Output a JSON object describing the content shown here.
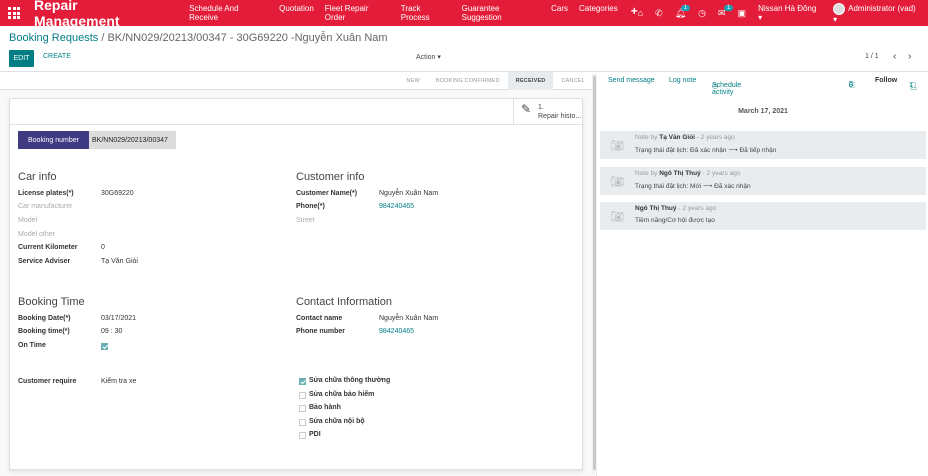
{
  "app": {
    "title": "Repair Management"
  },
  "menu": [
    "Schedule And Receive",
    "Quotation",
    "Fleet Repair Order",
    "Track Process",
    "Guarantee Suggestion",
    "Cars",
    "Categories"
  ],
  "systray": {
    "msg_count": "1",
    "chat_count": "1",
    "company": "Nissan Hà Đông",
    "user": "Administrator (vad)"
  },
  "breadcrumb": {
    "parent": "Booking Requests",
    "sep": "/",
    "current": "BK/NN029/20213/00347 - 30G69220 -Nguyễn Xuân Nam"
  },
  "buttons": {
    "edit": "EDIT",
    "create": "CREATE",
    "action": "Action",
    "pager": "1 / 1"
  },
  "stages": [
    "NEW",
    "BOOKING CONFIRMED",
    "RECEIVED",
    "CANCEL"
  ],
  "active_stage": "RECEIVED",
  "smart_button": {
    "count": "1.",
    "label": "Repair histo..."
  },
  "booking": {
    "label": "Booking number",
    "value": "BK/NN029/20213/00347"
  },
  "car_info": {
    "title": "Car info",
    "license_label": "License plates(*)",
    "license": "30G69220",
    "manufacturer_label": "Car manufacturer",
    "model_label": "Model",
    "model_other_label": "Model other",
    "km_label": "Current Kilometer",
    "km": "0",
    "adviser_label": "Service Adviser",
    "adviser": "Tạ Văn Giỏi"
  },
  "customer_info": {
    "title": "Customer info",
    "name_label": "Customer Name(*)",
    "name": "Nguyễn Xuân Nam",
    "phone_label": "Phone(*)",
    "phone": "984240465",
    "street_label": "Street"
  },
  "booking_time": {
    "title": "Booking Time",
    "date_label": "Booking Date(*)",
    "date": "03/17/2021",
    "time_label": "Booking time(*)",
    "time": "09 : 30",
    "ontime_label": "On Time",
    "ontime": true
  },
  "contact": {
    "title": "Contact Information",
    "name_label": "Contact name",
    "name": "Nguyễn Xuân Nam",
    "phone_label": "Phone number",
    "phone": "984240465"
  },
  "require": {
    "label": "Customer require",
    "value": "Kiểm tra xe"
  },
  "services": [
    {
      "label": "Sửa chữa thông thường",
      "checked": true
    },
    {
      "label": "Sửa chữa bảo hiểm",
      "checked": false
    },
    {
      "label": "Bảo hành",
      "checked": false
    },
    {
      "label": "Sửa chữa nội bộ",
      "checked": false
    },
    {
      "label": "PDI",
      "checked": false
    }
  ],
  "chatter": {
    "send": "Send message",
    "log": "Log note",
    "schedule": "Schedule activity",
    "attachments": "0",
    "follow": "Follow",
    "followers": "1",
    "date": "March 17, 2021",
    "messages": [
      {
        "prefix": "Note by",
        "author": "Tạ Văn Giỏi",
        "time": "- 2 years ago",
        "text": "Trạng thái đặt lịch: Đã xác nhận ⟶ Đã tiếp nhận"
      },
      {
        "prefix": "Note by",
        "author": "Ngô Thị Thuý",
        "time": "- 2 years ago",
        "text": "Trạng thái đặt lịch: Mới ⟶ Đã xác nhận"
      },
      {
        "prefix": "",
        "author": "Ngô Thị Thuý",
        "time": "- 2 years ago",
        "text": "Tiềm năng/Cơ hội được tạo"
      }
    ]
  },
  "colors": {
    "topbar": "#e31d39",
    "accent": "#017e84",
    "booking_label_bg": "#3f3a82"
  }
}
